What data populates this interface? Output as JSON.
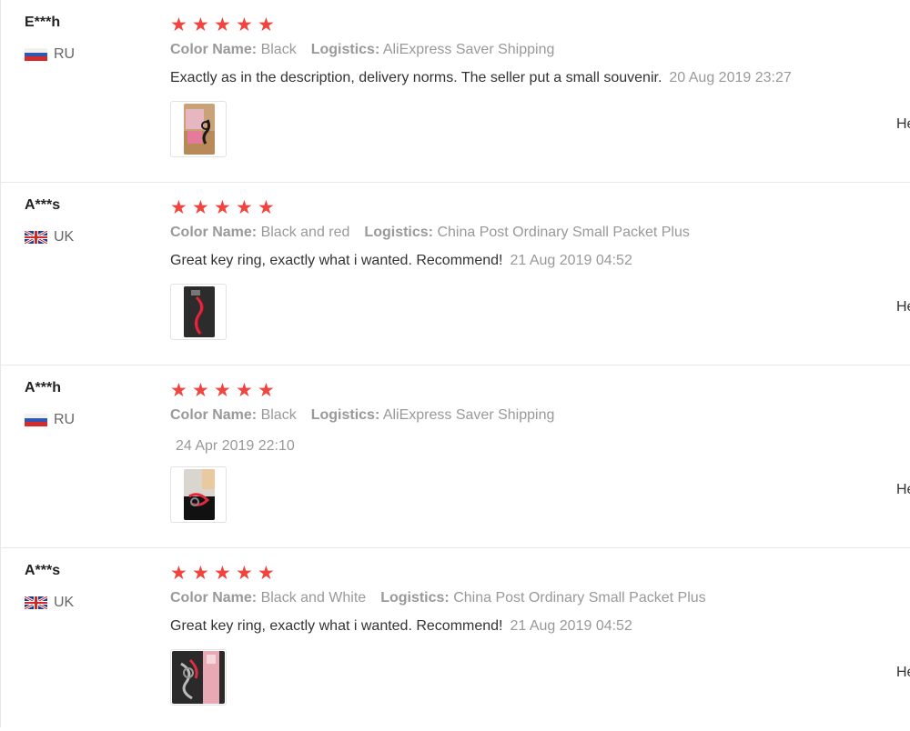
{
  "reviews": [
    {
      "user": "E***h",
      "country": "RU",
      "flag": "russia-flag",
      "stars": 5,
      "color_label": "Color Name:",
      "color_value": "Black",
      "logistics_label": "Logistics:",
      "logistics_value": "AliExpress Saver Shipping",
      "comment": "Exactly as in the description, delivery norms. The seller put a small souvenir.",
      "date": "20 Aug 2019 23:27",
      "helpful_label": "He"
    },
    {
      "user": "A***s",
      "country": "UK",
      "flag": "uk-flag",
      "stars": 5,
      "color_label": "Color Name:",
      "color_value": "Black and red",
      "logistics_label": "Logistics:",
      "logistics_value": "China Post Ordinary Small Packet Plus",
      "comment": "Great key ring, exactly what i wanted. Recommend!",
      "date": "21 Aug 2019 04:52",
      "helpful_label": "He"
    },
    {
      "user": "A***h",
      "country": "RU",
      "flag": "russia-flag",
      "stars": 5,
      "color_label": "Color Name:",
      "color_value": "Black",
      "logistics_label": "Logistics:",
      "logistics_value": "AliExpress Saver Shipping",
      "comment": "",
      "date": "24 Apr 2019 22:10",
      "helpful_label": "He"
    },
    {
      "user": "A***s",
      "country": "UK",
      "flag": "uk-flag",
      "stars": 5,
      "color_label": "Color Name:",
      "color_value": "Black and White",
      "logistics_label": "Logistics:",
      "logistics_value": "China Post Ordinary Small Packet Plus",
      "comment": "Great key ring, exactly what i wanted. Recommend!",
      "date": "21 Aug 2019 04:52",
      "helpful_label": "He"
    }
  ],
  "colors": {
    "star": "#f0443f",
    "muted_text": "#999999",
    "text": "#333333",
    "divider": "#e8e8e8"
  }
}
